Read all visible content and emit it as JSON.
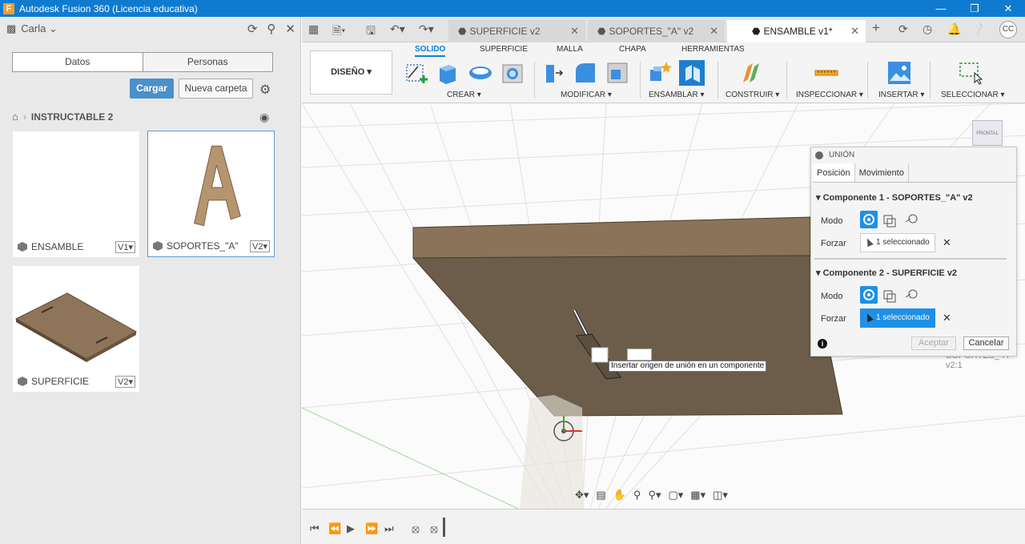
{
  "window": {
    "title": "Autodesk Fusion 360 (Licencia educativa)",
    "logo": "F"
  },
  "datapanel": {
    "user": "Carla",
    "tabs": [
      "Datos",
      "Personas"
    ],
    "upload_label": "Cargar",
    "new_folder_label": "Nueva carpeta",
    "breadcrumb_folder": "INSTRUCTABLE 2",
    "files": [
      {
        "name": "ENSAMBLE",
        "version": "V1▾"
      },
      {
        "name": "SOPORTES_\"A\"",
        "version": "V2▾"
      },
      {
        "name": "SUPERFICIE",
        "version": "V2▾"
      }
    ]
  },
  "doc_tabs": [
    {
      "label": "SUPERFICIE v2"
    },
    {
      "label": "SOPORTES_\"A\" v2"
    },
    {
      "label": "ENSAMBLE v1*"
    }
  ],
  "user_initials": "CC",
  "toolbar": {
    "workspace": "DISEÑO ▾",
    "tabs": [
      "SOLIDO",
      "SUPERFICIE",
      "MALLA",
      "CHAPA",
      "HERRAMIENTAS"
    ],
    "groups": [
      "CREAR ▾",
      "MODIFICAR ▾",
      "ENSAMBLAR ▾",
      "CONSTRUIR ▾",
      "INSPECCIONAR ▾",
      "INSERTAR ▾",
      "SELECCIONAR ▾"
    ]
  },
  "dialog": {
    "title": "UNIÓN",
    "tabs": [
      "Posición",
      "Movimiento"
    ],
    "component1": {
      "title": "▾ Componente 1 - SOPORTES_\"A\" v2",
      "mode_label": "Modo",
      "force_label": "Forzar",
      "force_value": "1 seleccionado"
    },
    "component2": {
      "title": "▾ Componente 2 - SUPERFICIE v2",
      "mode_label": "Modo",
      "force_label": "Forzar",
      "force_value": "1 seleccionado"
    },
    "accept_label": "Aceptar",
    "cancel_label": "Cancelar"
  },
  "canvas": {
    "tooltip": "Insertar origen de unión en un componente",
    "viewcube_label": "FRONTAL",
    "browser_text": "SOPORTES_\"A\" v2:1"
  }
}
